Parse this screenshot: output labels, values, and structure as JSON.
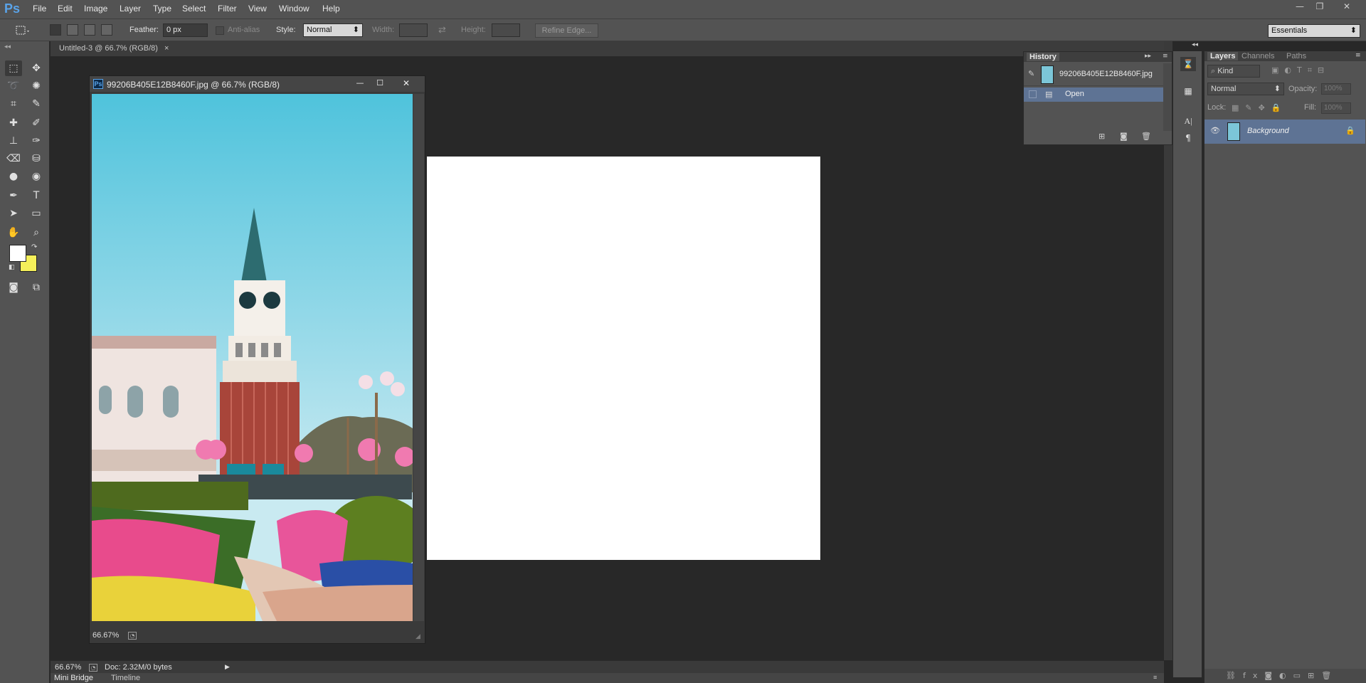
{
  "app": {
    "logo": "Ps"
  },
  "menu": [
    "File",
    "Edit",
    "Image",
    "Layer",
    "Type",
    "Select",
    "Filter",
    "View",
    "Window",
    "Help"
  ],
  "window_controls": {
    "minimize": "—",
    "restore": "❐",
    "close": "✕"
  },
  "options": {
    "feather_label": "Feather:",
    "feather_value": "0 px",
    "antialias_label": "Anti-alias",
    "style_label": "Style:",
    "style_value": "Normal",
    "width_label": "Width:",
    "height_label": "Height:",
    "refine_edge": "Refine Edge...",
    "workspace": "Essentials"
  },
  "doc_tab": {
    "title": "Untitled-3 @ 66.7% (RGB/8)",
    "close": "×"
  },
  "float_window": {
    "title": "99206B405E12B8460F.jpg @ 66.7% (RGB/8)",
    "zoom": "66.67%"
  },
  "status": {
    "zoom": "66.67%",
    "doc": "Doc: 2.32M/0 bytes"
  },
  "bottom_tabs": [
    "Mini Bridge",
    "Timeline"
  ],
  "history": {
    "tab": "History",
    "snapshot": "99206B405E12B8460F.jpg",
    "state": "Open"
  },
  "layers": {
    "tabs": [
      "Layers",
      "Channels",
      "Paths"
    ],
    "kind": "Kind",
    "blend": "Normal",
    "opacity_label": "Opacity:",
    "opacity_value": "100%",
    "lock_label": "Lock:",
    "fill_label": "Fill:",
    "fill_value": "100%",
    "layer_name": "Background"
  },
  "colors": {
    "foreground": "#ffffff",
    "background": "#f5f05a",
    "accent_blue": "#5aa3e8",
    "layer_selected": "#5e7394"
  }
}
